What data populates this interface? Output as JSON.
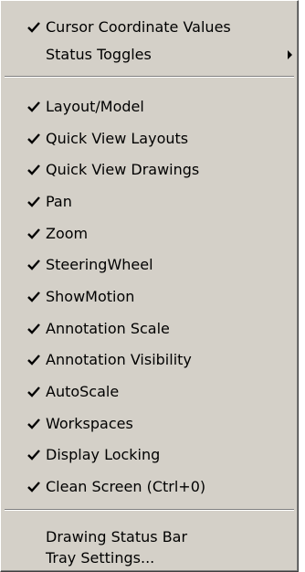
{
  "menu": {
    "items": [
      {
        "label": "Cursor Coordinate Values",
        "checked": true
      },
      {
        "label": "Status Toggles",
        "submenu": true
      },
      {
        "label": "Layout/Model",
        "checked": true
      },
      {
        "label": "Quick View Layouts",
        "checked": true
      },
      {
        "label": "Quick View Drawings",
        "checked": true
      },
      {
        "label": "Pan",
        "checked": true
      },
      {
        "label": "Zoom",
        "checked": true
      },
      {
        "label": "SteeringWheel",
        "checked": true
      },
      {
        "label": "ShowMotion",
        "checked": true
      },
      {
        "label": "Annotation Scale",
        "checked": true
      },
      {
        "label": "Annotation Visibility",
        "checked": true
      },
      {
        "label": "AutoScale",
        "checked": true
      },
      {
        "label": "Workspaces",
        "checked": true
      },
      {
        "label": "Display Locking",
        "checked": true
      },
      {
        "label": "Clean Screen (Ctrl+0)",
        "checked": true
      },
      {
        "label": "Drawing Status Bar"
      },
      {
        "label": "Tray Settings..."
      }
    ]
  },
  "icons": {
    "check": "checkmark-icon",
    "submenu": "submenu-arrow-icon"
  },
  "colors": {
    "menu_background": "#d4d0c8",
    "text": "#000000"
  }
}
